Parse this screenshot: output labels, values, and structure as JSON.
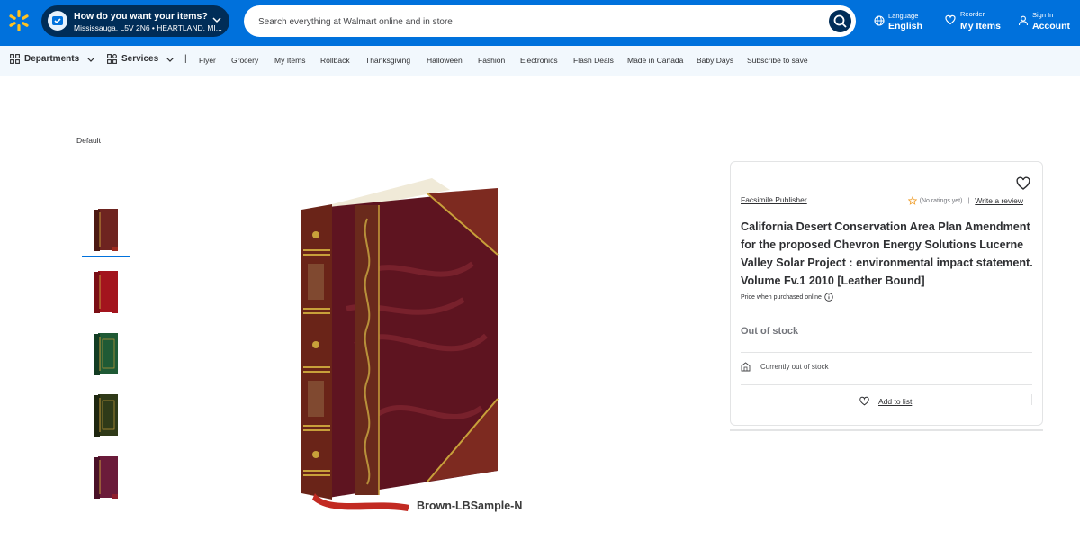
{
  "header": {
    "fulfillment": {
      "title": "How do you want your items?",
      "location": "Mississauga, L5V 2N6 • HEARTLAND, MI..."
    },
    "search": {
      "placeholder": "Search everything at Walmart online and in store"
    },
    "language": {
      "label": "Language",
      "value": "English"
    },
    "reorder": {
      "label": "Reorder",
      "value": "My Items"
    },
    "account": {
      "label": "Sign In",
      "value": "Account"
    }
  },
  "nav": {
    "departments": "Departments",
    "services": "Services",
    "separator": "|",
    "links": [
      "Flyer",
      "Grocery",
      "My Items",
      "Rollback",
      "Thanksgiving",
      "Halloween",
      "Fashion",
      "Electronics",
      "Flash Deals",
      "Made in Canada",
      "Baby Days",
      "Subscribe to save"
    ]
  },
  "gallery": {
    "default_label": "Default",
    "image_caption": "Brown-LBSample-N",
    "thumbnails": [
      {
        "color": "#7a2a22",
        "selected": true
      },
      {
        "color": "#a3141d",
        "selected": false
      },
      {
        "color": "#1f5a35",
        "selected": false
      },
      {
        "color": "#2f3a18",
        "selected": false
      },
      {
        "color": "#6b1b3a",
        "selected": false
      }
    ]
  },
  "product": {
    "seller": "Facsimile Publisher",
    "ratings": "(No ratings yet)",
    "ratings_separator": "|",
    "write_review": "Write a review",
    "title": "California Desert Conservation Area Plan Amendment for the proposed Chevron Energy Solutions Lucerne Valley Solar Project : environmental impact statement. Volume Fv.1 2010 [Leather Bound]",
    "price_when_purchased": "Price when purchased online",
    "status": "Out of stock",
    "availability": "Currently out of stock",
    "add_to_list": "Add to list"
  },
  "colors": {
    "brand_blue": "#0071dc",
    "dark_blue": "#002d58",
    "spark_yellow": "#ffc220",
    "nav_bg": "#f2f8fd"
  }
}
